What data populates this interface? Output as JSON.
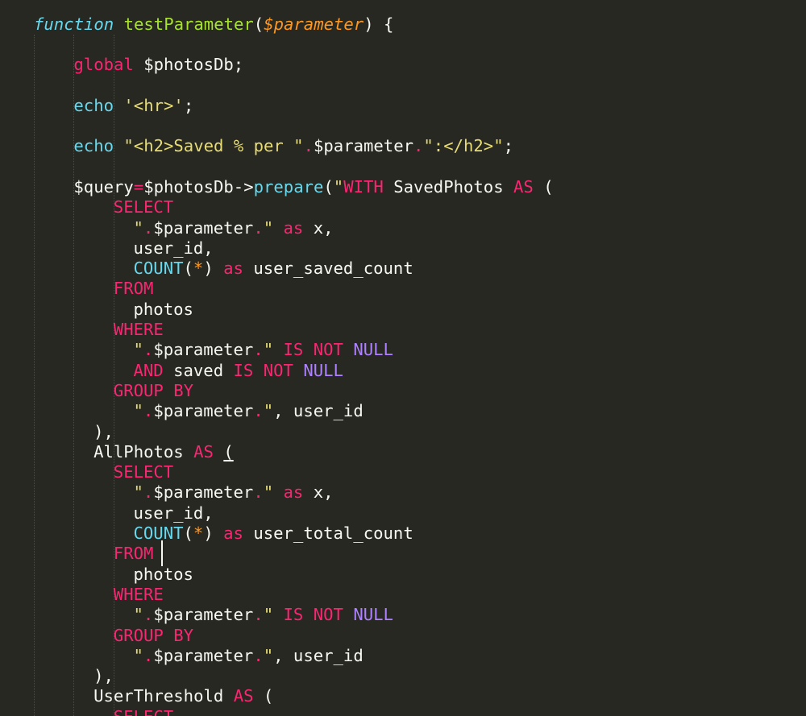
{
  "editor": {
    "theme_colors": {
      "background": "#272822",
      "storage": "#66d9ef",
      "function_name": "#a6e22e",
      "parameter": "#fd971f",
      "keyword": "#f92672",
      "string": "#e6db74",
      "constant": "#ae81ff",
      "text": "#f8f8f2"
    },
    "lines": [
      {
        "indent": 0,
        "tokens": [
          {
            "t": "storage",
            "v": "function"
          },
          {
            "t": "plain",
            "v": " "
          },
          {
            "t": "fn",
            "v": "testParameter"
          },
          {
            "t": "plain",
            "v": "("
          },
          {
            "t": "param",
            "v": "$parameter"
          },
          {
            "t": "plain",
            "v": ") {"
          }
        ]
      },
      {
        "indent": 0,
        "tokens": []
      },
      {
        "indent": 4,
        "tokens": [
          {
            "t": "kw",
            "v": "global"
          },
          {
            "t": "plain",
            "v": " $photosDb;"
          }
        ]
      },
      {
        "indent": 0,
        "tokens": []
      },
      {
        "indent": 4,
        "tokens": [
          {
            "t": "builtin",
            "v": "echo"
          },
          {
            "t": "plain",
            "v": " "
          },
          {
            "t": "string",
            "v": "'<hr>'"
          },
          {
            "t": "plain",
            "v": ";"
          }
        ]
      },
      {
        "indent": 0,
        "tokens": []
      },
      {
        "indent": 4,
        "tokens": [
          {
            "t": "builtin",
            "v": "echo"
          },
          {
            "t": "plain",
            "v": " "
          },
          {
            "t": "string",
            "v": "\"<h2>Saved % per \""
          },
          {
            "t": "kw",
            "v": "."
          },
          {
            "t": "plain",
            "v": "$parameter"
          },
          {
            "t": "kw",
            "v": "."
          },
          {
            "t": "string",
            "v": "\":</h2>\""
          },
          {
            "t": "plain",
            "v": ";"
          }
        ]
      },
      {
        "indent": 0,
        "tokens": []
      },
      {
        "indent": 4,
        "tokens": [
          {
            "t": "plain",
            "v": "$query"
          },
          {
            "t": "op",
            "v": "="
          },
          {
            "t": "plain",
            "v": "$photosDb->"
          },
          {
            "t": "builtin",
            "v": "prepare"
          },
          {
            "t": "plain",
            "v": "("
          },
          {
            "t": "string",
            "v": "\""
          },
          {
            "t": "kw",
            "v": "WITH"
          },
          {
            "t": "plain",
            "v": " SavedPhotos "
          },
          {
            "t": "kw",
            "v": "AS"
          },
          {
            "t": "plain",
            "v": " ("
          }
        ]
      },
      {
        "indent": 8,
        "tokens": [
          {
            "t": "kw",
            "v": "SELECT"
          }
        ]
      },
      {
        "indent": 10,
        "tokens": [
          {
            "t": "string",
            "v": "\""
          },
          {
            "t": "kw",
            "v": "."
          },
          {
            "t": "plain",
            "v": "$parameter"
          },
          {
            "t": "kw",
            "v": "."
          },
          {
            "t": "string",
            "v": "\""
          },
          {
            "t": "plain",
            "v": " "
          },
          {
            "t": "kw",
            "v": "as"
          },
          {
            "t": "plain",
            "v": " x,"
          }
        ]
      },
      {
        "indent": 10,
        "tokens": [
          {
            "t": "plain",
            "v": "user_id,"
          }
        ]
      },
      {
        "indent": 10,
        "tokens": [
          {
            "t": "builtin",
            "v": "COUNT"
          },
          {
            "t": "plain",
            "v": "("
          },
          {
            "t": "star",
            "v": "*"
          },
          {
            "t": "plain",
            "v": ") "
          },
          {
            "t": "kw",
            "v": "as"
          },
          {
            "t": "plain",
            "v": " user_saved_count"
          }
        ]
      },
      {
        "indent": 8,
        "tokens": [
          {
            "t": "kw",
            "v": "FROM"
          }
        ]
      },
      {
        "indent": 10,
        "tokens": [
          {
            "t": "plain",
            "v": "photos"
          }
        ]
      },
      {
        "indent": 8,
        "tokens": [
          {
            "t": "kw",
            "v": "WHERE"
          }
        ]
      },
      {
        "indent": 10,
        "tokens": [
          {
            "t": "string",
            "v": "\""
          },
          {
            "t": "kw",
            "v": "."
          },
          {
            "t": "plain",
            "v": "$parameter"
          },
          {
            "t": "kw",
            "v": "."
          },
          {
            "t": "string",
            "v": "\""
          },
          {
            "t": "plain",
            "v": " "
          },
          {
            "t": "kw",
            "v": "IS NOT"
          },
          {
            "t": "plain",
            "v": " "
          },
          {
            "t": "const",
            "v": "NULL"
          }
        ]
      },
      {
        "indent": 10,
        "tokens": [
          {
            "t": "kw",
            "v": "AND"
          },
          {
            "t": "plain",
            "v": " saved "
          },
          {
            "t": "kw",
            "v": "IS NOT"
          },
          {
            "t": "plain",
            "v": " "
          },
          {
            "t": "const",
            "v": "NULL"
          }
        ]
      },
      {
        "indent": 8,
        "tokens": [
          {
            "t": "kw",
            "v": "GROUP BY"
          }
        ]
      },
      {
        "indent": 10,
        "tokens": [
          {
            "t": "string",
            "v": "\""
          },
          {
            "t": "kw",
            "v": "."
          },
          {
            "t": "plain",
            "v": "$parameter"
          },
          {
            "t": "kw",
            "v": "."
          },
          {
            "t": "string",
            "v": "\""
          },
          {
            "t": "plain",
            "v": ", user_id"
          }
        ]
      },
      {
        "indent": 6,
        "tokens": [
          {
            "t": "plain",
            "v": "),"
          }
        ]
      },
      {
        "indent": 6,
        "tokens": [
          {
            "t": "plain",
            "v": "AllPhotos "
          },
          {
            "t": "kw",
            "v": "AS"
          },
          {
            "t": "plain",
            "v": " "
          },
          {
            "t": "ul",
            "v": "("
          }
        ]
      },
      {
        "indent": 8,
        "tokens": [
          {
            "t": "kw",
            "v": "SELECT"
          }
        ]
      },
      {
        "indent": 10,
        "tokens": [
          {
            "t": "string",
            "v": "\""
          },
          {
            "t": "kw",
            "v": "."
          },
          {
            "t": "plain",
            "v": "$parameter"
          },
          {
            "t": "kw",
            "v": "."
          },
          {
            "t": "string",
            "v": "\""
          },
          {
            "t": "plain",
            "v": " "
          },
          {
            "t": "kw",
            "v": "as"
          },
          {
            "t": "plain",
            "v": " x,"
          }
        ]
      },
      {
        "indent": 10,
        "tokens": [
          {
            "t": "plain",
            "v": "user_id,"
          }
        ]
      },
      {
        "indent": 10,
        "tokens": [
          {
            "t": "builtin",
            "v": "COUNT"
          },
          {
            "t": "plain",
            "v": "("
          },
          {
            "t": "star",
            "v": "*"
          },
          {
            "t": "plain",
            "v": ") "
          },
          {
            "t": "kw",
            "v": "as"
          },
          {
            "t": "plain",
            "v": " user_total_count"
          }
        ]
      },
      {
        "indent": 8,
        "tokens": [
          {
            "t": "kw",
            "v": "FROM"
          },
          {
            "t": "plain",
            "v": " "
          }
        ],
        "caret": true
      },
      {
        "indent": 10,
        "tokens": [
          {
            "t": "plain",
            "v": "photos"
          }
        ]
      },
      {
        "indent": 8,
        "tokens": [
          {
            "t": "kw",
            "v": "WHERE"
          }
        ]
      },
      {
        "indent": 10,
        "tokens": [
          {
            "t": "string",
            "v": "\""
          },
          {
            "t": "kw",
            "v": "."
          },
          {
            "t": "plain",
            "v": "$parameter"
          },
          {
            "t": "kw",
            "v": "."
          },
          {
            "t": "string",
            "v": "\""
          },
          {
            "t": "plain",
            "v": " "
          },
          {
            "t": "kw",
            "v": "IS NOT"
          },
          {
            "t": "plain",
            "v": " "
          },
          {
            "t": "const",
            "v": "NULL"
          }
        ]
      },
      {
        "indent": 8,
        "tokens": [
          {
            "t": "kw",
            "v": "GROUP BY"
          }
        ]
      },
      {
        "indent": 10,
        "tokens": [
          {
            "t": "string",
            "v": "\""
          },
          {
            "t": "kw",
            "v": "."
          },
          {
            "t": "plain",
            "v": "$parameter"
          },
          {
            "t": "kw",
            "v": "."
          },
          {
            "t": "string",
            "v": "\""
          },
          {
            "t": "plain",
            "v": ", user_id"
          }
        ]
      },
      {
        "indent": 6,
        "tokens": [
          {
            "t": "plain",
            "v": "),"
          }
        ]
      },
      {
        "indent": 6,
        "tokens": [
          {
            "t": "plain",
            "v": "UserThreshold "
          },
          {
            "t": "kw",
            "v": "AS"
          },
          {
            "t": "plain",
            "v": " ("
          }
        ]
      },
      {
        "indent": 8,
        "tokens": [
          {
            "t": "kw",
            "v": "SELECT"
          }
        ]
      }
    ]
  }
}
